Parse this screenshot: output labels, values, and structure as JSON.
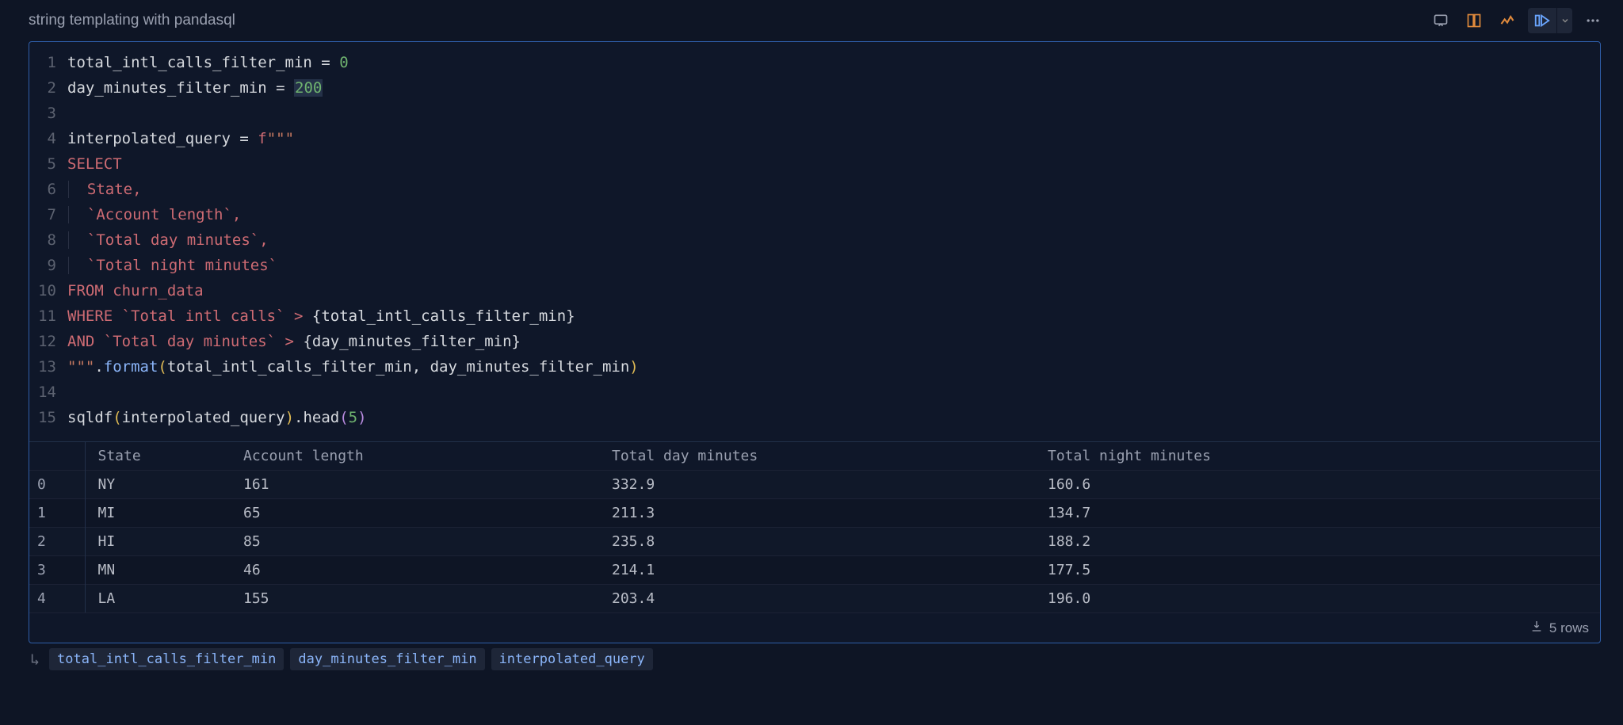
{
  "header": {
    "title": "string templating with pandasql"
  },
  "toolbar": {
    "comment_icon": "comment",
    "layout_icon": "layout",
    "chart_icon": "chart",
    "run_icon": "run",
    "chevron_icon": "chevron-down",
    "more_icon": "more"
  },
  "code": {
    "line_count": 15,
    "l1_var": "total_intl_calls_filter_min",
    "l1_eq": " = ",
    "l1_val": "0",
    "l2_var": "day_minutes_filter_min",
    "l2_eq": " = ",
    "l2_val": "200",
    "l4_var": "interpolated_query",
    "l4_eq": " = ",
    "l4_f": "f",
    "l4_q": "\"\"\"",
    "l5": "SELECT",
    "l6": "  State,",
    "l7": "  `Account length`,",
    "l8": "  `Total day minutes`,",
    "l9": "  `Total night minutes`",
    "l10_a": "FROM",
    "l10_b": " churn_data",
    "l11_a": "WHERE",
    "l11_b": " `Total intl calls` > ",
    "l11_c": "{total_intl_calls_filter_min}",
    "l12_a": "AND",
    "l12_b": " `Total day minutes` > ",
    "l12_c": "{day_minutes_filter_min}",
    "l13_q": "\"\"\"",
    "l13_dot": ".",
    "l13_fmt": "format",
    "l13_po": "(",
    "l13_args": "total_intl_calls_filter_min, day_minutes_filter_min",
    "l13_pc": ")",
    "l15_a": "sqldf",
    "l15_po": "(",
    "l15_b": "interpolated_query",
    "l15_pc": ")",
    "l15_c": ".head",
    "l15_po2": "(",
    "l15_d": "5",
    "l15_pc2": ")"
  },
  "table": {
    "columns": [
      "State",
      "Account length",
      "Total day minutes",
      "Total night minutes"
    ],
    "rows": [
      {
        "idx": "0",
        "state": "NY",
        "acct": "161",
        "day": "332.9",
        "night": "160.6"
      },
      {
        "idx": "1",
        "state": "MI",
        "acct": "65",
        "day": "211.3",
        "night": "134.7"
      },
      {
        "idx": "2",
        "state": "HI",
        "acct": "85",
        "day": "235.8",
        "night": "188.2"
      },
      {
        "idx": "3",
        "state": "MN",
        "acct": "46",
        "day": "214.1",
        "night": "177.5"
      },
      {
        "idx": "4",
        "state": "LA",
        "acct": "155",
        "day": "203.4",
        "night": "196.0"
      }
    ],
    "footer_rows": "5 rows"
  },
  "vars": {
    "a": "total_intl_calls_filter_min",
    "b": "day_minutes_filter_min",
    "c": "interpolated_query"
  }
}
